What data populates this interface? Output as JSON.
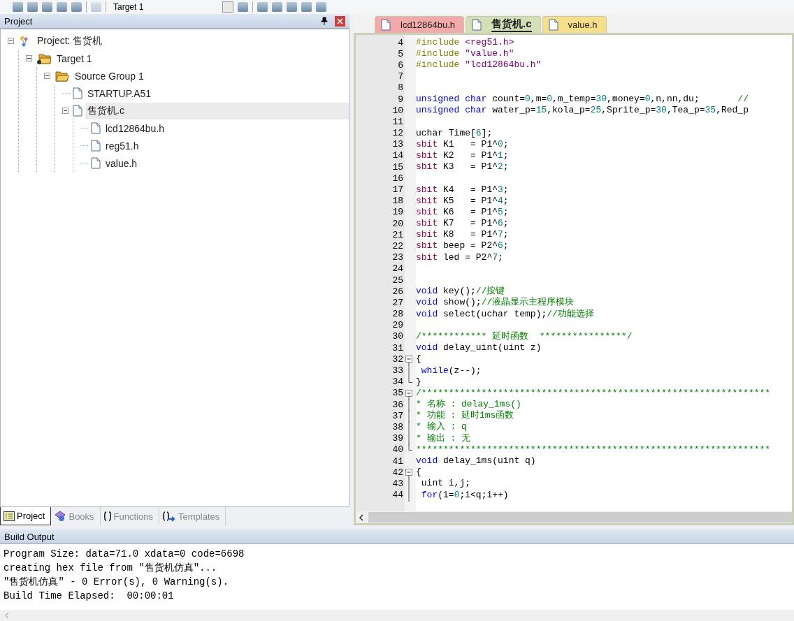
{
  "toolbar": {
    "target": "Target 1"
  },
  "project_panel": {
    "title": "Project",
    "tree": [
      {
        "label": "Project: 售货机",
        "kind": "project",
        "expanded": true,
        "selected": false,
        "children": [
          {
            "label": "Target 1",
            "kind": "target",
            "expanded": true,
            "selected": false,
            "children": [
              {
                "label": "Source Group 1",
                "kind": "group",
                "expanded": true,
                "selected": false,
                "children": [
                  {
                    "label": "STARTUP.A51",
                    "kind": "file",
                    "selected": false
                  },
                  {
                    "label": "售货机.c",
                    "kind": "file",
                    "expanded": true,
                    "selected": true,
                    "children": [
                      {
                        "label": "lcd12864bu.h",
                        "kind": "file",
                        "selected": false
                      },
                      {
                        "label": "reg51.h",
                        "kind": "file",
                        "selected": false
                      },
                      {
                        "label": "value.h",
                        "kind": "file",
                        "selected": false
                      }
                    ]
                  }
                ]
              }
            ]
          }
        ]
      }
    ],
    "tabs": [
      {
        "label": "Project",
        "kind": "project",
        "selected": true
      },
      {
        "label": "Books",
        "kind": "books",
        "selected": false
      },
      {
        "label": "Functions",
        "kind": "functions",
        "selected": false
      },
      {
        "label": "Templates",
        "kind": "templates",
        "selected": false
      }
    ]
  },
  "editor": {
    "tabs": [
      {
        "label": "lcd12864bu.h",
        "color": "#f2a9a9",
        "selected": false
      },
      {
        "label": "售货机.c",
        "color": "#d3dfb5",
        "selected": true
      },
      {
        "label": "value.h",
        "color": "#f7de8a",
        "selected": false
      }
    ],
    "lines": [
      {
        "n": "4",
        "tokens": [
          {
            "kind": "pre",
            "text": "#include "
          },
          {
            "kind": "str",
            "text": "<reg51.h>"
          }
        ]
      },
      {
        "n": "5",
        "tokens": [
          {
            "kind": "pre",
            "text": "#include "
          },
          {
            "kind": "str",
            "text": "\"value.h\""
          }
        ]
      },
      {
        "n": "6",
        "tokens": [
          {
            "kind": "pre",
            "text": "#include "
          },
          {
            "kind": "str",
            "text": "\"lcd12864bu.h\""
          }
        ]
      },
      {
        "n": "7"
      },
      {
        "n": "8"
      },
      {
        "n": "9",
        "tokens": [
          {
            "kind": "kw",
            "text": "unsigned char "
          },
          {
            "kind": "plain",
            "text": "count="
          },
          {
            "kind": "num",
            "text": "0"
          },
          {
            "kind": "plain",
            "text": ",m="
          },
          {
            "kind": "num",
            "text": "0"
          },
          {
            "kind": "plain",
            "text": ",m_temp="
          },
          {
            "kind": "num",
            "text": "30"
          },
          {
            "kind": "plain",
            "text": ",money="
          },
          {
            "kind": "num",
            "text": "0"
          },
          {
            "kind": "plain",
            "text": ",n,nn,du;       "
          },
          {
            "kind": "cmt",
            "text": "//"
          }
        ]
      },
      {
        "n": "10",
        "tokens": [
          {
            "kind": "kw",
            "text": "unsigned char "
          },
          {
            "kind": "plain",
            "text": "water_p="
          },
          {
            "kind": "num",
            "text": "15"
          },
          {
            "kind": "plain",
            "text": ",kola_p="
          },
          {
            "kind": "num",
            "text": "25"
          },
          {
            "kind": "plain",
            "text": ",Sprite_p="
          },
          {
            "kind": "num",
            "text": "30"
          },
          {
            "kind": "plain",
            "text": ",Tea_p="
          },
          {
            "kind": "num",
            "text": "35"
          },
          {
            "kind": "plain",
            "text": ",Red_p"
          }
        ]
      },
      {
        "n": "11"
      },
      {
        "n": "12",
        "tokens": [
          {
            "kind": "plain",
            "text": "uchar Time["
          },
          {
            "kind": "num",
            "text": "6"
          },
          {
            "kind": "plain",
            "text": "];"
          }
        ]
      },
      {
        "n": "13",
        "tokens": [
          {
            "kind": "sfr",
            "text": "sbit "
          },
          {
            "kind": "plain",
            "text": "K1   = P1^"
          },
          {
            "kind": "num",
            "text": "0"
          },
          {
            "kind": "plain",
            "text": ";"
          }
        ]
      },
      {
        "n": "14",
        "tokens": [
          {
            "kind": "sfr",
            "text": "sbit "
          },
          {
            "kind": "plain",
            "text": "K2   = P1^"
          },
          {
            "kind": "num",
            "text": "1"
          },
          {
            "kind": "plain",
            "text": ";"
          }
        ]
      },
      {
        "n": "15",
        "tokens": [
          {
            "kind": "sfr",
            "text": "sbit "
          },
          {
            "kind": "plain",
            "text": "K3   = P1^"
          },
          {
            "kind": "num",
            "text": "2"
          },
          {
            "kind": "plain",
            "text": ";"
          }
        ]
      },
      {
        "n": "16"
      },
      {
        "n": "17",
        "tokens": [
          {
            "kind": "sfr",
            "text": "sbit "
          },
          {
            "kind": "plain",
            "text": "K4   = P1^"
          },
          {
            "kind": "num",
            "text": "3"
          },
          {
            "kind": "plain",
            "text": ";"
          }
        ]
      },
      {
        "n": "18",
        "tokens": [
          {
            "kind": "sfr",
            "text": "sbit "
          },
          {
            "kind": "plain",
            "text": "K5   = P1^"
          },
          {
            "kind": "num",
            "text": "4"
          },
          {
            "kind": "plain",
            "text": ";"
          }
        ]
      },
      {
        "n": "19",
        "tokens": [
          {
            "kind": "sfr",
            "text": "sbit "
          },
          {
            "kind": "plain",
            "text": "K6   = P1^"
          },
          {
            "kind": "num",
            "text": "5"
          },
          {
            "kind": "plain",
            "text": ";"
          }
        ]
      },
      {
        "n": "20",
        "tokens": [
          {
            "kind": "sfr",
            "text": "sbit "
          },
          {
            "kind": "plain",
            "text": "K7   = P1^"
          },
          {
            "kind": "num",
            "text": "6"
          },
          {
            "kind": "plain",
            "text": ";"
          }
        ]
      },
      {
        "n": "21",
        "tokens": [
          {
            "kind": "sfr",
            "text": "sbit "
          },
          {
            "kind": "plain",
            "text": "K8   = P1^"
          },
          {
            "kind": "num",
            "text": "7"
          },
          {
            "kind": "plain",
            "text": ";"
          }
        ]
      },
      {
        "n": "22",
        "tokens": [
          {
            "kind": "sfr",
            "text": "sbit "
          },
          {
            "kind": "plain",
            "text": "beep = P2^"
          },
          {
            "kind": "num",
            "text": "6"
          },
          {
            "kind": "plain",
            "text": ";"
          }
        ]
      },
      {
        "n": "23",
        "tokens": [
          {
            "kind": "sfr",
            "text": "sbit "
          },
          {
            "kind": "plain",
            "text": "led = P2^"
          },
          {
            "kind": "num",
            "text": "7"
          },
          {
            "kind": "plain",
            "text": ";"
          }
        ]
      },
      {
        "n": "24"
      },
      {
        "n": "25"
      },
      {
        "n": "26",
        "tokens": [
          {
            "kind": "kw",
            "text": "void "
          },
          {
            "kind": "plain",
            "text": "key();"
          },
          {
            "kind": "cmt",
            "text": "//按键"
          }
        ]
      },
      {
        "n": "27",
        "tokens": [
          {
            "kind": "kw",
            "text": "void "
          },
          {
            "kind": "plain",
            "text": "show();"
          },
          {
            "kind": "cmt",
            "text": "//液晶显示主程序模块"
          }
        ]
      },
      {
        "n": "28",
        "tokens": [
          {
            "kind": "kw",
            "text": "void "
          },
          {
            "kind": "plain",
            "text": "select(uchar temp);"
          },
          {
            "kind": "cmt",
            "text": "//功能选择"
          }
        ]
      },
      {
        "n": "29"
      },
      {
        "n": "30",
        "tokens": [
          {
            "kind": "cmt",
            "text": "/************ 延时函数  ****************/"
          }
        ]
      },
      {
        "n": "31",
        "tokens": [
          {
            "kind": "kw",
            "text": "void "
          },
          {
            "kind": "plain",
            "text": "delay_uint(uint z)"
          }
        ]
      },
      {
        "n": "32",
        "kind": "fold_start",
        "tokens": [
          {
            "kind": "plain",
            "text": "{"
          }
        ]
      },
      {
        "n": "33",
        "kind": "fold_line",
        "tokens": [
          {
            "kind": "kw",
            "text": " while"
          },
          {
            "kind": "plain",
            "text": "(z--);"
          }
        ]
      },
      {
        "n": "34",
        "kind": "fold_end",
        "tokens": [
          {
            "kind": "plain",
            "text": "}"
          }
        ]
      },
      {
        "n": "35",
        "kind": "fold_start",
        "tokens": [
          {
            "kind": "cmt",
            "text": "/****************************************************************"
          }
        ]
      },
      {
        "n": "36",
        "kind": "fold_line",
        "tokens": [
          {
            "kind": "cmt",
            "text": "* 名称 : delay_1ms()"
          }
        ]
      },
      {
        "n": "37",
        "kind": "fold_line",
        "tokens": [
          {
            "kind": "cmt",
            "text": "* 功能 : 延时1ms函数"
          }
        ]
      },
      {
        "n": "38",
        "kind": "fold_line",
        "tokens": [
          {
            "kind": "cmt",
            "text": "* 输入 : q"
          }
        ]
      },
      {
        "n": "39",
        "kind": "fold_line",
        "tokens": [
          {
            "kind": "cmt",
            "text": "* 输出 : 无"
          }
        ]
      },
      {
        "n": "40",
        "kind": "fold_end",
        "tokens": [
          {
            "kind": "cmt",
            "text": "*****************************************************************"
          }
        ]
      },
      {
        "n": "41",
        "tokens": [
          {
            "kind": "kw",
            "text": "void "
          },
          {
            "kind": "plain",
            "text": "delay_1ms(uint q)"
          }
        ]
      },
      {
        "n": "42",
        "kind": "fold_start",
        "tokens": [
          {
            "kind": "plain",
            "text": "{"
          }
        ]
      },
      {
        "n": "43",
        "kind": "fold_line",
        "tokens": [
          {
            "kind": "plain",
            "text": " uint i,j;"
          }
        ]
      },
      {
        "n": "44",
        "kind": "fold_line",
        "tokens": [
          {
            "kind": "kw",
            "text": " for"
          },
          {
            "kind": "plain",
            "text": "(i="
          },
          {
            "kind": "num",
            "text": "0"
          },
          {
            "kind": "plain",
            "text": ";i<q;i++)"
          }
        ]
      }
    ]
  },
  "build_output": {
    "title": "Build Output",
    "lines": [
      "Program Size: data=71.0 xdata=0 code=6698",
      "creating hex file from \"售货机仿真\"...",
      "\"售货机仿真\" - 0 Error(s), 0 Warning(s).",
      "Build Time Elapsed:  00:00:01"
    ]
  }
}
